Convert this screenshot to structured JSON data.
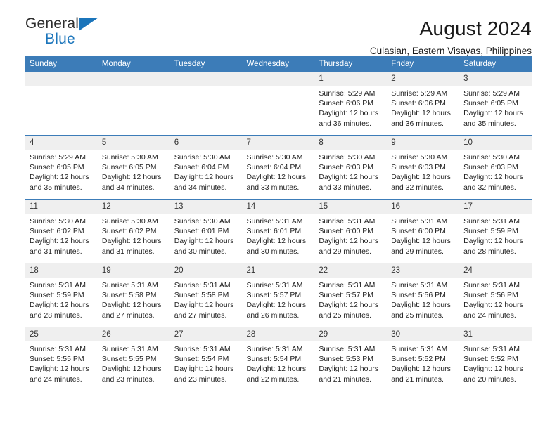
{
  "brand": {
    "name_top": "General",
    "name_bottom": "Blue",
    "triangle_color": "#1b75bb"
  },
  "header": {
    "month_title": "August 2024",
    "location": "Culasian, Eastern Visayas, Philippines"
  },
  "calendar": {
    "header_bg": "#3c7cb8",
    "daynum_bg": "#efefef",
    "weekday_labels": [
      "Sunday",
      "Monday",
      "Tuesday",
      "Wednesday",
      "Thursday",
      "Friday",
      "Saturday"
    ],
    "weeks": [
      [
        {
          "day": "",
          "empty": true
        },
        {
          "day": "",
          "empty": true
        },
        {
          "day": "",
          "empty": true
        },
        {
          "day": "",
          "empty": true
        },
        {
          "day": "1",
          "sunrise": "Sunrise: 5:29 AM",
          "sunset": "Sunset: 6:06 PM",
          "daylight1": "Daylight: 12 hours",
          "daylight2": "and 36 minutes."
        },
        {
          "day": "2",
          "sunrise": "Sunrise: 5:29 AM",
          "sunset": "Sunset: 6:06 PM",
          "daylight1": "Daylight: 12 hours",
          "daylight2": "and 36 minutes."
        },
        {
          "day": "3",
          "sunrise": "Sunrise: 5:29 AM",
          "sunset": "Sunset: 6:05 PM",
          "daylight1": "Daylight: 12 hours",
          "daylight2": "and 35 minutes."
        }
      ],
      [
        {
          "day": "4",
          "sunrise": "Sunrise: 5:29 AM",
          "sunset": "Sunset: 6:05 PM",
          "daylight1": "Daylight: 12 hours",
          "daylight2": "and 35 minutes."
        },
        {
          "day": "5",
          "sunrise": "Sunrise: 5:30 AM",
          "sunset": "Sunset: 6:05 PM",
          "daylight1": "Daylight: 12 hours",
          "daylight2": "and 34 minutes."
        },
        {
          "day": "6",
          "sunrise": "Sunrise: 5:30 AM",
          "sunset": "Sunset: 6:04 PM",
          "daylight1": "Daylight: 12 hours",
          "daylight2": "and 34 minutes."
        },
        {
          "day": "7",
          "sunrise": "Sunrise: 5:30 AM",
          "sunset": "Sunset: 6:04 PM",
          "daylight1": "Daylight: 12 hours",
          "daylight2": "and 33 minutes."
        },
        {
          "day": "8",
          "sunrise": "Sunrise: 5:30 AM",
          "sunset": "Sunset: 6:03 PM",
          "daylight1": "Daylight: 12 hours",
          "daylight2": "and 33 minutes."
        },
        {
          "day": "9",
          "sunrise": "Sunrise: 5:30 AM",
          "sunset": "Sunset: 6:03 PM",
          "daylight1": "Daylight: 12 hours",
          "daylight2": "and 32 minutes."
        },
        {
          "day": "10",
          "sunrise": "Sunrise: 5:30 AM",
          "sunset": "Sunset: 6:03 PM",
          "daylight1": "Daylight: 12 hours",
          "daylight2": "and 32 minutes."
        }
      ],
      [
        {
          "day": "11",
          "sunrise": "Sunrise: 5:30 AM",
          "sunset": "Sunset: 6:02 PM",
          "daylight1": "Daylight: 12 hours",
          "daylight2": "and 31 minutes."
        },
        {
          "day": "12",
          "sunrise": "Sunrise: 5:30 AM",
          "sunset": "Sunset: 6:02 PM",
          "daylight1": "Daylight: 12 hours",
          "daylight2": "and 31 minutes."
        },
        {
          "day": "13",
          "sunrise": "Sunrise: 5:30 AM",
          "sunset": "Sunset: 6:01 PM",
          "daylight1": "Daylight: 12 hours",
          "daylight2": "and 30 minutes."
        },
        {
          "day": "14",
          "sunrise": "Sunrise: 5:31 AM",
          "sunset": "Sunset: 6:01 PM",
          "daylight1": "Daylight: 12 hours",
          "daylight2": "and 30 minutes."
        },
        {
          "day": "15",
          "sunrise": "Sunrise: 5:31 AM",
          "sunset": "Sunset: 6:00 PM",
          "daylight1": "Daylight: 12 hours",
          "daylight2": "and 29 minutes."
        },
        {
          "day": "16",
          "sunrise": "Sunrise: 5:31 AM",
          "sunset": "Sunset: 6:00 PM",
          "daylight1": "Daylight: 12 hours",
          "daylight2": "and 29 minutes."
        },
        {
          "day": "17",
          "sunrise": "Sunrise: 5:31 AM",
          "sunset": "Sunset: 5:59 PM",
          "daylight1": "Daylight: 12 hours",
          "daylight2": "and 28 minutes."
        }
      ],
      [
        {
          "day": "18",
          "sunrise": "Sunrise: 5:31 AM",
          "sunset": "Sunset: 5:59 PM",
          "daylight1": "Daylight: 12 hours",
          "daylight2": "and 28 minutes."
        },
        {
          "day": "19",
          "sunrise": "Sunrise: 5:31 AM",
          "sunset": "Sunset: 5:58 PM",
          "daylight1": "Daylight: 12 hours",
          "daylight2": "and 27 minutes."
        },
        {
          "day": "20",
          "sunrise": "Sunrise: 5:31 AM",
          "sunset": "Sunset: 5:58 PM",
          "daylight1": "Daylight: 12 hours",
          "daylight2": "and 27 minutes."
        },
        {
          "day": "21",
          "sunrise": "Sunrise: 5:31 AM",
          "sunset": "Sunset: 5:57 PM",
          "daylight1": "Daylight: 12 hours",
          "daylight2": "and 26 minutes."
        },
        {
          "day": "22",
          "sunrise": "Sunrise: 5:31 AM",
          "sunset": "Sunset: 5:57 PM",
          "daylight1": "Daylight: 12 hours",
          "daylight2": "and 25 minutes."
        },
        {
          "day": "23",
          "sunrise": "Sunrise: 5:31 AM",
          "sunset": "Sunset: 5:56 PM",
          "daylight1": "Daylight: 12 hours",
          "daylight2": "and 25 minutes."
        },
        {
          "day": "24",
          "sunrise": "Sunrise: 5:31 AM",
          "sunset": "Sunset: 5:56 PM",
          "daylight1": "Daylight: 12 hours",
          "daylight2": "and 24 minutes."
        }
      ],
      [
        {
          "day": "25",
          "sunrise": "Sunrise: 5:31 AM",
          "sunset": "Sunset: 5:55 PM",
          "daylight1": "Daylight: 12 hours",
          "daylight2": "and 24 minutes."
        },
        {
          "day": "26",
          "sunrise": "Sunrise: 5:31 AM",
          "sunset": "Sunset: 5:55 PM",
          "daylight1": "Daylight: 12 hours",
          "daylight2": "and 23 minutes."
        },
        {
          "day": "27",
          "sunrise": "Sunrise: 5:31 AM",
          "sunset": "Sunset: 5:54 PM",
          "daylight1": "Daylight: 12 hours",
          "daylight2": "and 23 minutes."
        },
        {
          "day": "28",
          "sunrise": "Sunrise: 5:31 AM",
          "sunset": "Sunset: 5:54 PM",
          "daylight1": "Daylight: 12 hours",
          "daylight2": "and 22 minutes."
        },
        {
          "day": "29",
          "sunrise": "Sunrise: 5:31 AM",
          "sunset": "Sunset: 5:53 PM",
          "daylight1": "Daylight: 12 hours",
          "daylight2": "and 21 minutes."
        },
        {
          "day": "30",
          "sunrise": "Sunrise: 5:31 AM",
          "sunset": "Sunset: 5:52 PM",
          "daylight1": "Daylight: 12 hours",
          "daylight2": "and 21 minutes."
        },
        {
          "day": "31",
          "sunrise": "Sunrise: 5:31 AM",
          "sunset": "Sunset: 5:52 PM",
          "daylight1": "Daylight: 12 hours",
          "daylight2": "and 20 minutes."
        }
      ]
    ]
  }
}
